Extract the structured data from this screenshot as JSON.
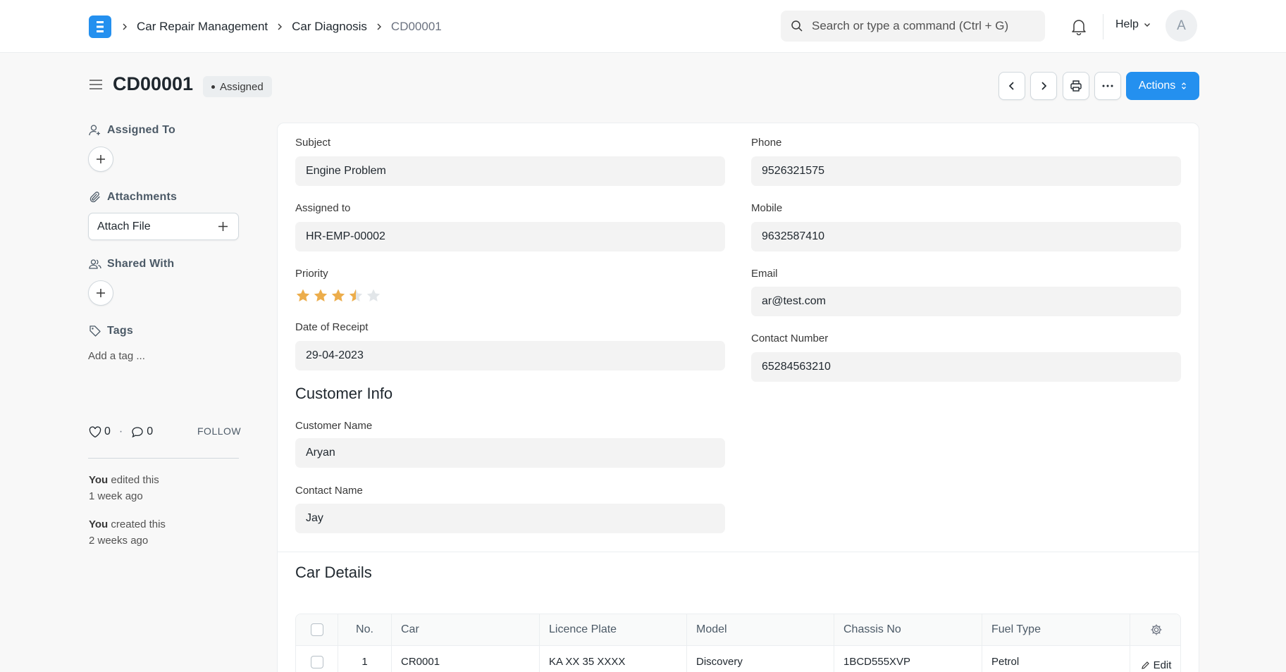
{
  "navbar": {
    "breadcrumbs": [
      "Car Repair Management",
      "Car Diagnosis",
      "CD00001"
    ],
    "search_placeholder": "Search or type a command (Ctrl + G)",
    "help_label": "Help",
    "avatar_letter": "A"
  },
  "page": {
    "title": "CD00001",
    "status": "Assigned",
    "actions_label": "Actions"
  },
  "sidebar": {
    "assigned_to_label": "Assigned To",
    "attachments_label": "Attachments",
    "attach_file_label": "Attach File",
    "shared_with_label": "Shared With",
    "tags_label": "Tags",
    "add_tag_label": "Add a tag ...",
    "likes_count": "0",
    "comments_count": "0",
    "follow_label": "FOLLOW",
    "activity": [
      {
        "who": "You",
        "action": "edited this",
        "when": "1 week ago"
      },
      {
        "who": "You",
        "action": "created this",
        "when": "2 weeks ago"
      }
    ]
  },
  "form": {
    "subject_label": "Subject",
    "subject_value": "Engine Problem",
    "assigned_label": "Assigned to",
    "assigned_value": "HR-EMP-00002",
    "priority_label": "Priority",
    "priority_rating": 3.5,
    "priority_max": 5,
    "date_label": "Date of Receipt",
    "date_value": "29-04-2023",
    "phone_label": "Phone",
    "phone_value": "9526321575",
    "mobile_label": "Mobile",
    "mobile_value": "9632587410",
    "email_label": "Email",
    "email_value": "ar@test.com",
    "contact_number_label": "Contact Number",
    "contact_number_value": "65284563210",
    "customer_section": "Customer Info",
    "customer_name_label": "Customer Name",
    "customer_name_value": "Aryan",
    "contact_name_label": "Contact Name",
    "contact_name_value": "Jay",
    "car_section": "Car Details"
  },
  "table": {
    "headers": [
      "No.",
      "Car",
      "Licence Plate",
      "Model",
      "Chassis No",
      "Fuel Type"
    ],
    "rows": [
      {
        "no": "1",
        "car": "CR0001",
        "plate": "KA XX 35 XXXX",
        "model": "Discovery",
        "chassis": "1BCD555XVP",
        "fuel": "Petrol"
      }
    ],
    "edit_label": "Edit"
  },
  "colors": {
    "primary": "#2490ef",
    "star": "#ecad4b",
    "star_empty": "#e2e6e9"
  }
}
